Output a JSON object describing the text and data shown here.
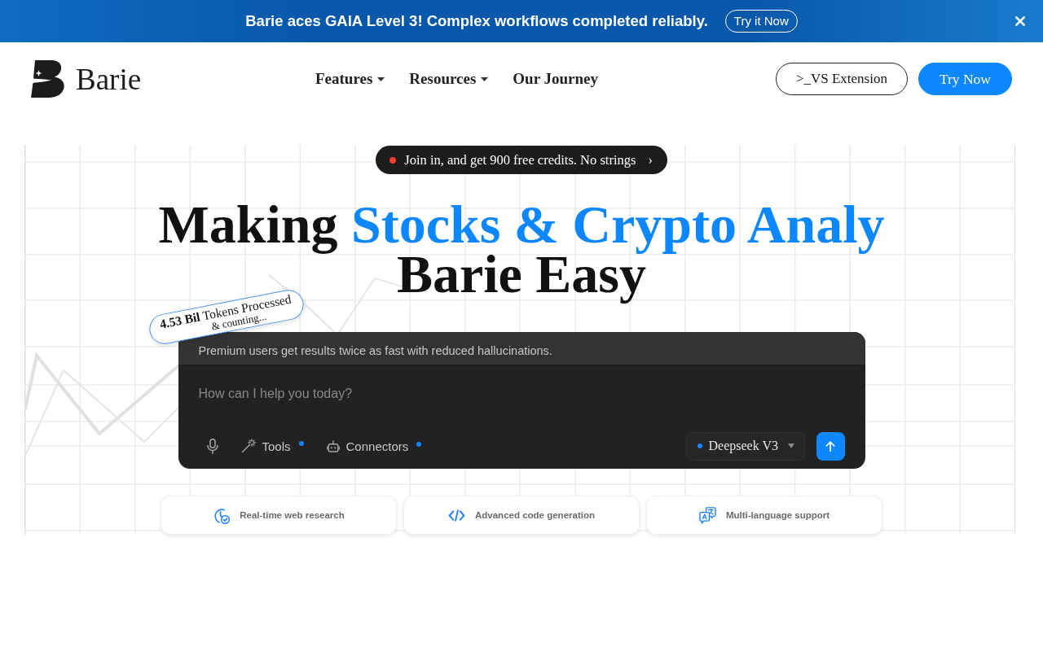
{
  "banner": {
    "message": "Barie aces GAIA Level 3! Complex workflows completed reliably.",
    "button": "Try it Now"
  },
  "header": {
    "logo_text": "Barie",
    "nav": [
      {
        "label": "Features",
        "dropdown": true
      },
      {
        "label": "Resources",
        "dropdown": true
      },
      {
        "label": "Our Journey",
        "dropdown": false
      }
    ],
    "buttons": [
      {
        "label": ">_VS Extension",
        "kind": "outline"
      },
      {
        "label": "Try Now",
        "kind": "primary"
      }
    ]
  },
  "hero": {
    "announcement": {
      "text": "Join in, and get 900 free credits. No strings",
      "arrow": "›"
    },
    "headline": {
      "lines": [
        [
          {
            "text": "Making",
            "highlight": false
          },
          {
            "text": "Stocks & Crypto Analy",
            "highlight": true
          }
        ],
        [
          {
            "text": "Barie Easy",
            "highlight": false
          }
        ]
      ]
    },
    "token_badge": {
      "text": "**4.53 Bil** Tokens Processed",
      "subtext": "& counting..."
    },
    "chat": {
      "notice": "Premium users get results twice as fast with reduced hallucinations.",
      "placeholder": "How can I help you today?",
      "tools": [
        {
          "label": "Tools",
          "kind": "tools",
          "indicator": true
        },
        {
          "label": "Connectors",
          "kind": "connectors",
          "indicator": true
        }
      ],
      "model": "Deepseek V3"
    },
    "features": [
      {
        "label": "Real-time web research",
        "kind": "research"
      },
      {
        "label": "Advanced code generation",
        "kind": "code"
      },
      {
        "label": "Multi-language support",
        "kind": "language"
      }
    ]
  }
}
